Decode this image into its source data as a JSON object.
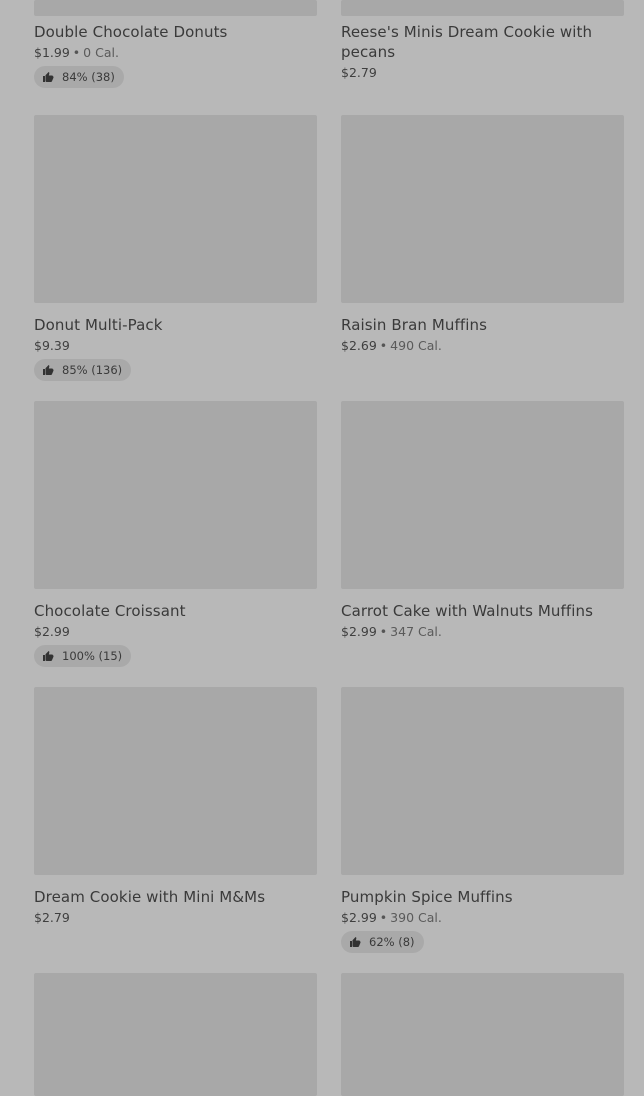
{
  "products": [
    {
      "name": "Double Chocolate Donuts",
      "price": "$1.99",
      "calories": "0 Cal.",
      "rating": "84% (38)"
    },
    {
      "name": "Reese's Minis Dream Cookie with pecans",
      "price": "$2.79",
      "calories": null,
      "rating": null
    },
    {
      "name": "Donut Multi-Pack",
      "price": "$9.39",
      "calories": null,
      "rating": "85% (136)"
    },
    {
      "name": "Raisin Bran Muffins",
      "price": "$2.69",
      "calories": "490 Cal.",
      "rating": null
    },
    {
      "name": "Chocolate Croissant",
      "price": "$2.99",
      "calories": null,
      "rating": "100% (15)"
    },
    {
      "name": "Carrot Cake with Walnuts Muffins",
      "price": "$2.99",
      "calories": "347 Cal.",
      "rating": null
    },
    {
      "name": "Dream Cookie with Mini M&Ms",
      "price": "$2.79",
      "calories": null,
      "rating": null
    },
    {
      "name": "Pumpkin Spice Muffins",
      "price": "$2.99",
      "calories": "390 Cal.",
      "rating": "62% (8)"
    }
  ],
  "separator": "•",
  "icons": {
    "rating": "thumbs-up-icon"
  },
  "colors": {
    "overlay": "#b8b8b8",
    "thumb": "#a8a8a8",
    "text": "#3a3a3a"
  }
}
